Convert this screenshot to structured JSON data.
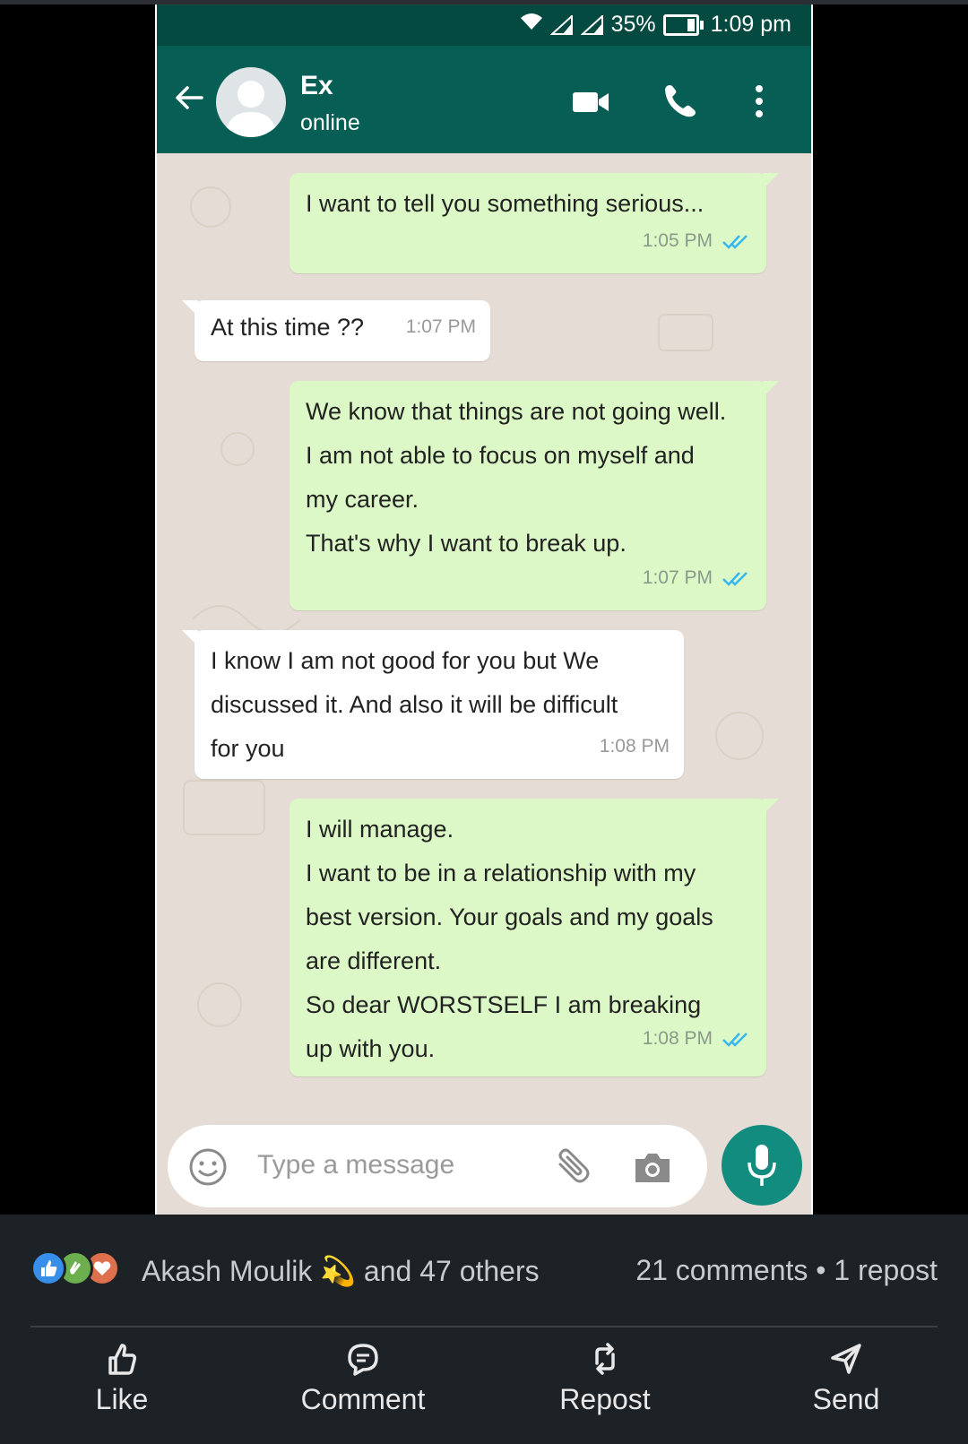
{
  "status_bar": {
    "battery": "35%",
    "time": "1:09 pm"
  },
  "contact": {
    "name": "Ex",
    "status": "online"
  },
  "messages": [
    {
      "side": "out",
      "lines": [
        "I want to tell you something serious..."
      ],
      "time": "1:05 PM",
      "read": true
    },
    {
      "side": "in",
      "lines": [
        "At this time ??"
      ],
      "time": "1:07 PM"
    },
    {
      "side": "out",
      "lines": [
        "We know that things are not going well.",
        "I am not able to focus on myself and",
        "my career.",
        "That's why I want to break up."
      ],
      "time": "1:07 PM",
      "read": true
    },
    {
      "side": "in",
      "lines": [
        "I know I am not good for you but We",
        "discussed it. And also it will be difficult",
        "for you"
      ],
      "time": "1:08 PM"
    },
    {
      "side": "out",
      "lines": [
        "I will manage.",
        "I want to be in a relationship with my",
        "best version. Your goals and my goals",
        "are different.",
        "So dear WORSTSELF I am breaking",
        "up with you."
      ],
      "time": "1:08 PM",
      "read": true
    }
  ],
  "composer": {
    "placeholder": "Type a message"
  },
  "social": {
    "reactor_name": "Akash Moulik",
    "reactor_suffix": "and 47 others",
    "counts": "21 comments • 1 repost",
    "actions": {
      "like": "Like",
      "comment": "Comment",
      "repost": "Repost",
      "send": "Send"
    }
  },
  "colors": {
    "header": "#075e54",
    "status_bar": "#054a41",
    "outgoing_bubble": "#dcf8c6",
    "incoming_bubble": "#ffffff",
    "read_tick": "#34b7f1",
    "mic_button": "#128c7e",
    "footer_bg": "#1d2226"
  }
}
